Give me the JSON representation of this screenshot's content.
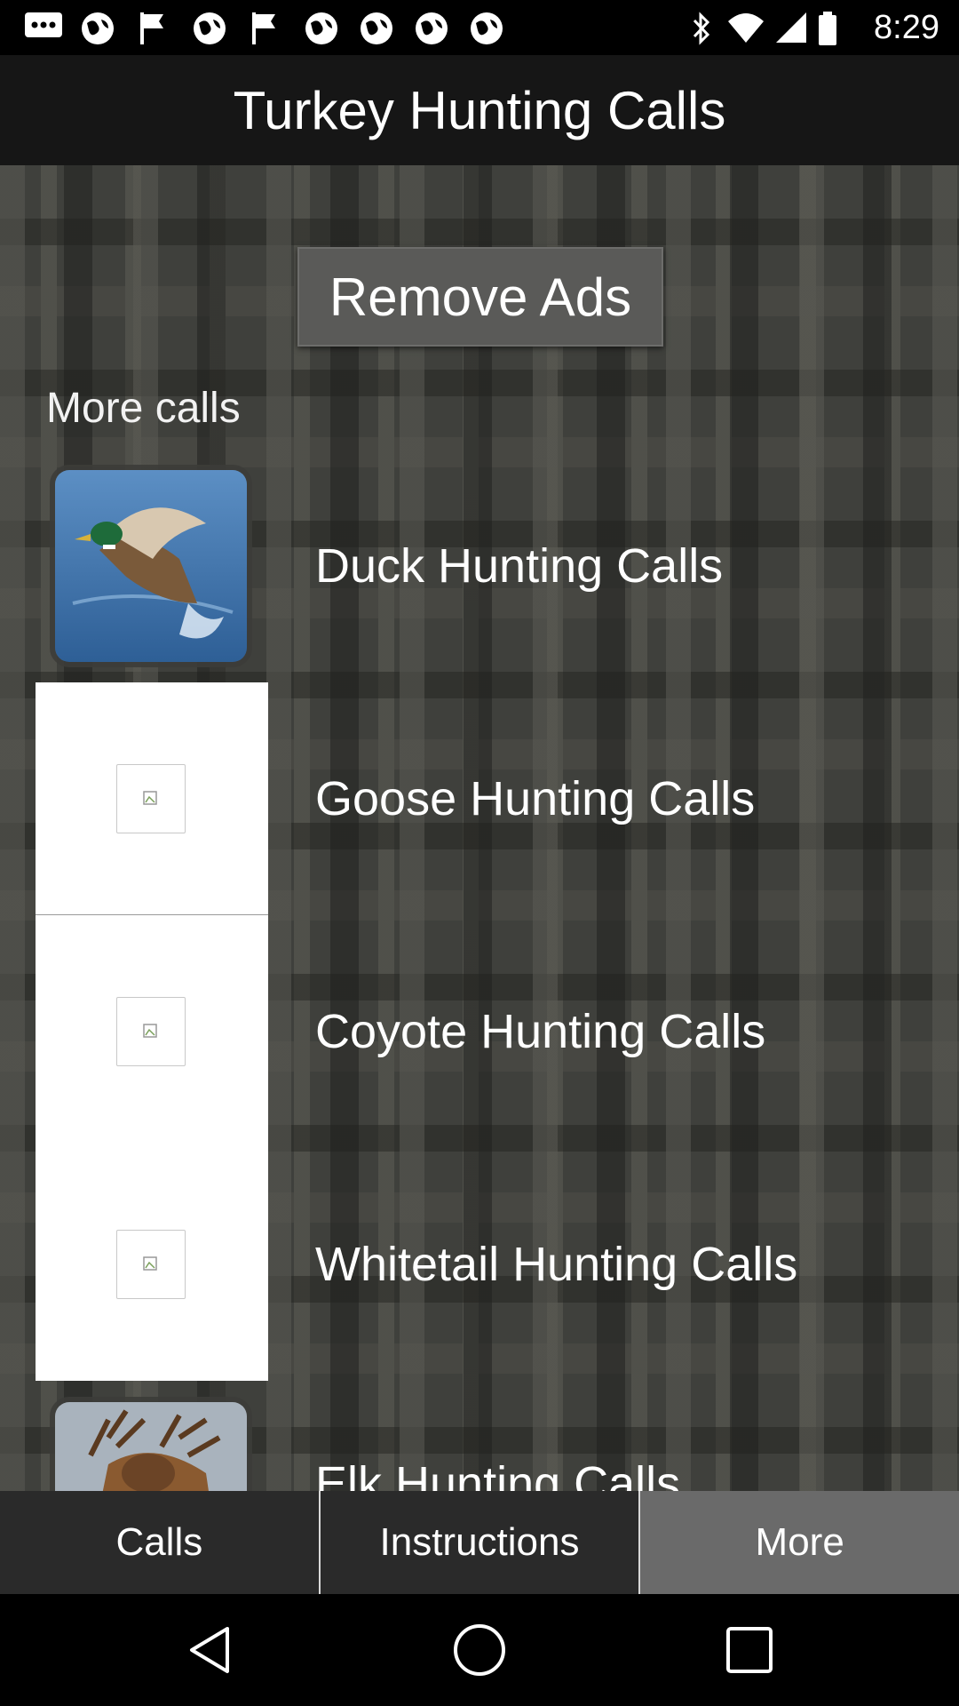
{
  "status_bar": {
    "time": "8:29",
    "left_icons": [
      "message-icon",
      "globe-icon",
      "flag-icon",
      "globe-icon",
      "flag-icon",
      "globe-icon",
      "globe-icon",
      "globe-icon"
    ],
    "right_icons": [
      "bluetooth-icon",
      "wifi-icon",
      "signal-icon",
      "battery-icon"
    ]
  },
  "header": {
    "title": "Turkey Hunting Calls"
  },
  "remove_ads": {
    "label": "Remove Ads"
  },
  "more_calls": {
    "heading": "More calls",
    "items": [
      {
        "label": "Duck Hunting Calls",
        "thumbnail": "duck-photo"
      },
      {
        "label": "Goose Hunting Calls",
        "thumbnail": "broken-image"
      },
      {
        "label": "Coyote Hunting Calls",
        "thumbnail": "broken-image"
      },
      {
        "label": "Whitetail Hunting Calls",
        "thumbnail": "broken-image"
      },
      {
        "label": "Elk Hunting Calls",
        "thumbnail": "elk-photo"
      }
    ]
  },
  "tabs": [
    {
      "label": "Calls",
      "active": false
    },
    {
      "label": "Instructions",
      "active": false
    },
    {
      "label": "More",
      "active": true
    }
  ],
  "nav": {
    "buttons": [
      "back-icon",
      "home-icon",
      "recents-icon"
    ]
  },
  "colors": {
    "tab_active": "#6a6a6a",
    "tab_inactive": "#2a2a2a",
    "title_bar": "#161616"
  }
}
